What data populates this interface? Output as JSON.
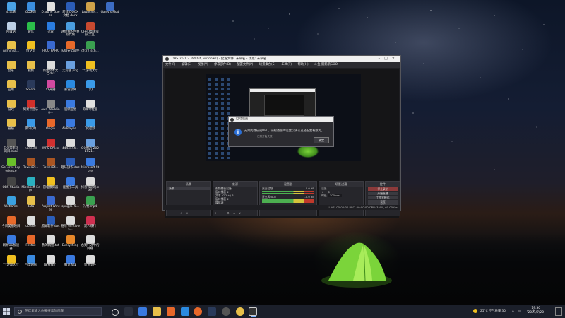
{
  "desktop_icons": [
    {
      "label": "此电脑",
      "color": "#4aa3e8"
    },
    {
      "label": "QQ游戏",
      "color": "#3a8ee0"
    },
    {
      "label": "Draw & Guess",
      "color": "#e0e0e0"
    },
    {
      "label": "新建 DOCX 文档.docx",
      "color": "#2b5db8"
    },
    {
      "label": "Launcher...",
      "color": "#cfa24a"
    },
    {
      "label": "Garry's Mod",
      "color": "#3c6cc4"
    },
    {
      "label": "回收站",
      "color": "#bcd0e6"
    },
    {
      "label": "微信",
      "color": "#2bbf4a"
    },
    {
      "label": "迅雷",
      "color": "#2a7de1"
    },
    {
      "label": "迷你我的世界 取代网",
      "color": "#4a9ee0"
    },
    {
      "label": "CFHD高清竞技大区",
      "color": "#c84a30"
    },
    {
      "label": "Administ...",
      "color": "#e8c24a"
    },
    {
      "label": "YY语音",
      "color": "#f0c020"
    },
    {
      "label": "PICO PARK",
      "color": "#3a6ad0"
    },
    {
      "label": "火绒安全软件",
      "color": "#e86a2a"
    },
    {
      "label": "dfcr2Tsch...",
      "color": "#3aa050"
    },
    {
      "label": "音乐",
      "color": "#e8c04a"
    },
    {
      "label": "视频",
      "color": "#e8c04a"
    },
    {
      "label": "新建文本文档.txt",
      "color": "#dcdcdc"
    },
    {
      "label": "无标题.png",
      "color": "#6aa0e0"
    },
    {
      "label": "YY游戏大厅",
      "color": "#f0c020"
    },
    {
      "label": "应用",
      "color": "#e8c04a"
    },
    {
      "label": "Steam",
      "color": "#2a3a5a"
    },
    {
      "label": "YY开播",
      "color": "#d04aa0"
    },
    {
      "label": "暴雪战网",
      "color": "#2a8ae0"
    },
    {
      "label": "QQ",
      "color": "#3a9ae8"
    },
    {
      "label": "游戏",
      "color": "#e8c04a"
    },
    {
      "label": "网易云音乐",
      "color": "#d0302a"
    },
    {
      "label": "ow4 Wedding...",
      "color": "#888888"
    },
    {
      "label": "超级回复",
      "color": "#3a7ae0"
    },
    {
      "label": "美柯零化器",
      "color": "#e0e0e0"
    },
    {
      "label": "直播",
      "color": "#e8c04a"
    },
    {
      "label": "腾讯QQ",
      "color": "#3a9ae8"
    },
    {
      "label": "Origin",
      "color": "#e8682a"
    },
    {
      "label": "AirPlayer...",
      "color": "#3a7ae0"
    },
    {
      "label": "QQ后续",
      "color": "#3a9ae8"
    },
    {
      "label": "未分辨率化 的屏.mov",
      "color": "#555555"
    },
    {
      "label": "node.dll",
      "color": "#dcdcdc"
    },
    {
      "label": "WPS Office",
      "color": "#d03030"
    },
    {
      "label": "4444444...",
      "color": "#dcdcdc"
    },
    {
      "label": "QQ图片 2021021...",
      "color": "#6aa0e0"
    },
    {
      "label": "GeForce Experience",
      "color": "#6abf2a"
    },
    {
      "label": "TowerOf...",
      "color": "#aa5522"
    },
    {
      "label": "TowerOf...",
      "color": "#aa5522"
    },
    {
      "label": "趣味操作.doc",
      "color": "#2b5db8"
    },
    {
      "label": "Microsoft Store",
      "color": "#3a7ae0"
    },
    {
      "label": "OBS Studio",
      "color": "#444444"
    },
    {
      "label": "Microsoft Edge",
      "color": "#2ab0c0"
    },
    {
      "label": "雷电模拟器",
      "color": "#f0c020"
    },
    {
      "label": "截图小工具",
      "color": "#3a7ae0"
    },
    {
      "label": "抖音云游戏.exe",
      "color": "#dcdcdc"
    },
    {
      "label": "Wetlame",
      "color": "#3aa0e0"
    },
    {
      "label": "data",
      "color": "#e8c04a"
    },
    {
      "label": "Project Winter",
      "color": "#3a6ad0"
    },
    {
      "label": "spngjlaF5...",
      "color": "#dcdcdc"
    },
    {
      "label": "礼物.mp4",
      "color": "#3aa050"
    },
    {
      "label": "今日美播映屏",
      "color": "#e86a2a"
    },
    {
      "label": "up.exe",
      "color": "#dcdcdc"
    },
    {
      "label": "黑屏软件.doc",
      "color": "#2b5db8"
    },
    {
      "label": "随附 Windows...",
      "color": "#dcdcdc"
    },
    {
      "label": "双人成行",
      "color": "#d03050"
    },
    {
      "label": "网易UU加速器",
      "color": "#3a7ae0"
    },
    {
      "label": "Firefox",
      "color": "#e8682a"
    },
    {
      "label": "我的网络.txt",
      "color": "#dcdcdc"
    },
    {
      "label": "Everything",
      "color": "#e8882a"
    },
    {
      "label": "右我们过中的网络",
      "color": "#dcdcdc"
    },
    {
      "label": "YY游戏大厅",
      "color": "#f0c020"
    },
    {
      "label": "百度网盘",
      "color": "#3a8ae0"
    },
    {
      "label": "联系我们",
      "color": "#dcdcdc"
    },
    {
      "label": "腾讯会议",
      "color": "#3a7ae0"
    },
    {
      "label": "资讯文件",
      "color": "#dcdcdc"
    }
  ],
  "obs": {
    "title": "OBS 26.1.2 (64 bit, windows) - 配置文件: 未命名 - 场景: 未命名",
    "menu": [
      "文件(F)",
      "编辑(E)",
      "视图(V)",
      "停靠部件(D)",
      "配置文件(P)",
      "场景集合(S)",
      "工具(T)",
      "帮助(H)",
      "斗鱼·鹅鹅鹅GOO"
    ],
    "docks": {
      "scenes": {
        "title": "场景",
        "items": [
          "场景"
        ]
      },
      "sources": {
        "title": "来源",
        "items": [
          "视频捕获设备",
          "窗口捕获 2",
          "文本 (GDI+) 6",
          "窗口捕获 2",
          "媒体源"
        ]
      },
      "mixer": {
        "title": "混音器",
        "channels": [
          {
            "name": "桌面音频",
            "db": "-0.0 dB"
          },
          {
            "name": "麦克风/Aux",
            "db": "-0.0 dB"
          }
        ]
      },
      "transitions": {
        "title": "场景过渡",
        "type": "淡出",
        "duration_label": "时长",
        "duration": "300 ms"
      },
      "controls": {
        "title": "控件",
        "buttons": [
          "停止录制",
          "开始直播",
          "工作室模式",
          "设置",
          "退出"
        ]
      }
    },
    "status": "LIVE: 00:00:00   REC: 00:00:00   CPU: 3.4%, 60.00 fps"
  },
  "dialog": {
    "title": "自动设置",
    "message": "无效的路径或URL。请检查您的设置以确认已经配置有效的。",
    "sub": "记录开始失败",
    "ok": "确定"
  },
  "taskbar": {
    "search_placeholder": "在这里输入你要搜索的内容",
    "weather": "25°C 空气质量 30",
    "time": "19:30",
    "date": "2021/7/20"
  }
}
